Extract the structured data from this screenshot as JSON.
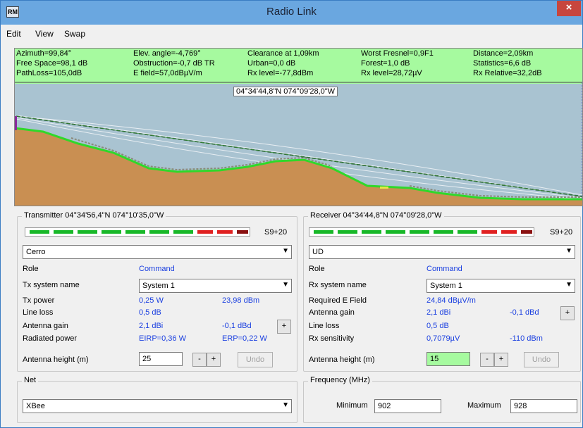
{
  "window": {
    "title": "Radio Link",
    "icon": "RM",
    "close": "×"
  },
  "menu": [
    "Edit",
    "View",
    "Swap"
  ],
  "info": {
    "row1": [
      "Azimuth=99,84°",
      "Elev. angle=-4,769°",
      "Clearance at 1,09km",
      "Worst Fresnel=0,9F1",
      "Distance=2,09km"
    ],
    "row2": [
      "Free Space=98,1 dB",
      "Obstruction=-0,7 dB TR",
      "Urban=0,0 dB",
      "Forest=1,0 dB",
      "Statistics=6,6 dB"
    ],
    "row3": [
      "PathLoss=105,0dB",
      "E field=57,0dBµV/m",
      "Rx level=-77,8dBm",
      "Rx level=28,72µV",
      "Rx Relative=32,2dB"
    ]
  },
  "profile": {
    "cursor_coord": "04°34'44,8\"N 074°09'28,0\"W",
    "terrain_color": "#c98f52",
    "sky_color": "#a9c3d1"
  },
  "transmitter": {
    "title": "Transmitter 04°34'56,4\"N 074°10'35,0\"W",
    "meter_value": "S9+20",
    "site": "Cerro",
    "role_label": "Role",
    "role_value": "Command",
    "system_label": "Tx system name",
    "system_value": "System  1",
    "power_label": "Tx power",
    "power_w": "0,25 W",
    "power_dbm": "23,98 dBm",
    "loss_label": "Line loss",
    "loss_value": "0,5 dB",
    "gain_label": "Antenna gain",
    "gain_dbi": "2,1 dBi",
    "gain_dbd": "-0,1 dBd",
    "radiated_label": "Radiated power",
    "eirp": "EIRP=0,36 W",
    "erp": "ERP=0,22 W",
    "height_label": "Antenna height (m)",
    "height_value": "25",
    "minus": "-",
    "plus": "+",
    "undo": "Undo"
  },
  "receiver": {
    "title": "Receiver 04°34'44,8\"N 074°09'28,0\"W",
    "meter_value": "S9+20",
    "site": "UD",
    "role_label": "Role",
    "role_value": "Command",
    "system_label": "Rx system name",
    "system_value": "System  1",
    "field_label": "Required E Field",
    "field_value": "24,84 dBµV/m",
    "gain_label": "Antenna gain",
    "gain_dbi": "2,1 dBi",
    "gain_dbd": "-0,1 dBd",
    "loss_label": "Line loss",
    "loss_value": "0,5 dB",
    "sens_label": "Rx sensitivity",
    "sens_uv": "0,7079µV",
    "sens_dbm": "-110 dBm",
    "height_label": "Antenna height (m)",
    "height_value": "15",
    "minus": "-",
    "plus": "+",
    "undo": "Undo"
  },
  "net": {
    "title": "Net",
    "value": "XBee"
  },
  "frequency": {
    "title": "Frequency (MHz)",
    "min_label": "Minimum",
    "min_value": "902",
    "max_label": "Maximum",
    "max_value": "928"
  }
}
